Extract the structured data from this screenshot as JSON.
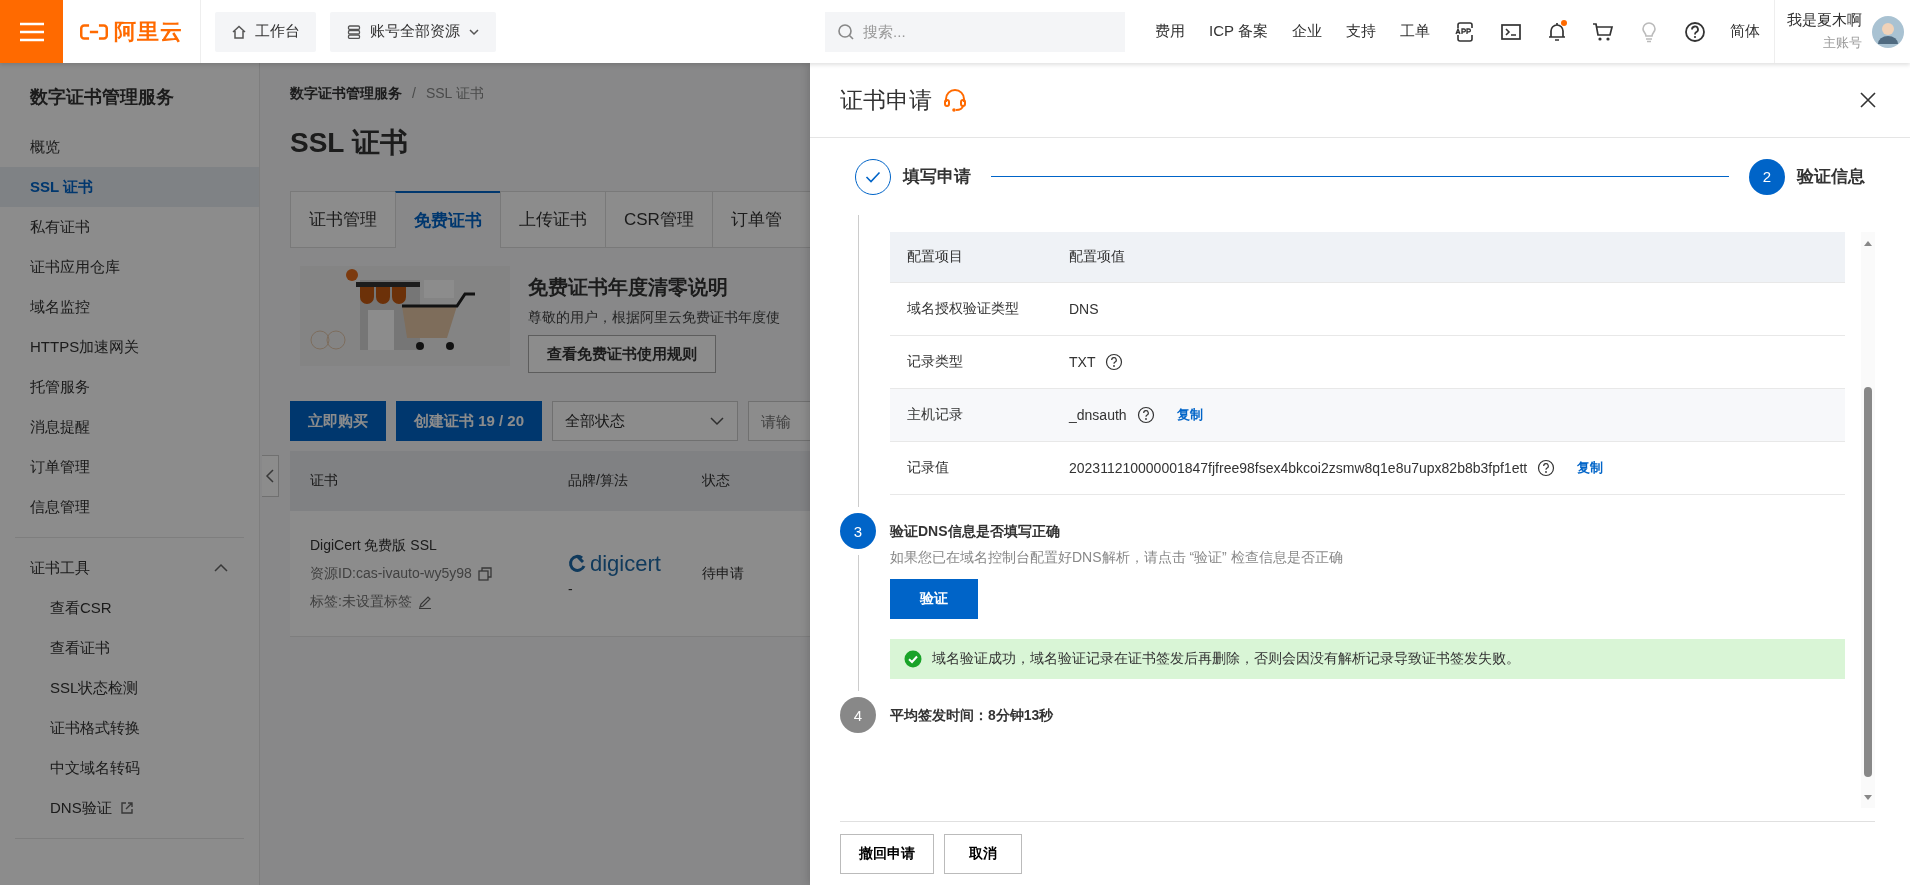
{
  "topbar": {
    "logo": "阿里云",
    "buttons": [
      {
        "kind": "home",
        "label": "工作台"
      },
      {
        "kind": "dropdown",
        "label": "账号全部资源"
      }
    ],
    "search": {
      "placeholder": "搜索..."
    },
    "links": [
      "费用",
      "ICP 备案",
      "企业",
      "支持",
      "工单"
    ],
    "icons": [
      {
        "kind": "app",
        "badge": false,
        "disabled": false
      },
      {
        "kind": "terminal",
        "badge": false,
        "disabled": false
      },
      {
        "kind": "bell",
        "badge": true,
        "disabled": false
      },
      {
        "kind": "cart",
        "badge": false,
        "disabled": false
      },
      {
        "kind": "bulb",
        "badge": false,
        "disabled": true
      },
      {
        "kind": "help",
        "badge": false,
        "disabled": false
      }
    ],
    "language": "简体",
    "user": {
      "name": "我是夏木啊",
      "role": "主账号"
    }
  },
  "sidebar": {
    "title": "数字证书管理服务",
    "items": [
      {
        "label": "概览",
        "selected": false
      },
      {
        "label": "SSL 证书",
        "selected": true
      },
      {
        "label": "私有证书",
        "selected": false
      },
      {
        "label": "证书应用仓库",
        "selected": false
      },
      {
        "label": "域名监控",
        "selected": false
      },
      {
        "label": "HTTPS加速网关",
        "selected": false
      },
      {
        "label": "托管服务",
        "selected": false
      },
      {
        "label": "消息提醒",
        "selected": false
      },
      {
        "label": "订单管理",
        "selected": false
      },
      {
        "label": "信息管理",
        "selected": false
      }
    ],
    "tools": {
      "label": "证书工具",
      "expanded": true,
      "items": [
        {
          "label": "查看CSR",
          "external": false
        },
        {
          "label": "查看证书",
          "external": false
        },
        {
          "label": "SSL状态检测",
          "external": false
        },
        {
          "label": "证书格式转换",
          "external": false
        },
        {
          "label": "中文域名转码",
          "external": false
        },
        {
          "label": "DNS验证",
          "external": true
        }
      ]
    }
  },
  "main": {
    "breadcrumb": {
      "items": [
        "数字证书管理服务",
        "SSL 证书"
      ],
      "separator": "/"
    },
    "title": "SSL 证书",
    "tabs": [
      {
        "label": "证书管理",
        "selected": false
      },
      {
        "label": "免费证书",
        "selected": true
      },
      {
        "label": "上传证书",
        "selected": false
      },
      {
        "label": "CSR管理",
        "selected": false
      },
      {
        "label": "订单管",
        "selected": false
      }
    ],
    "notice": {
      "title": "免费证书年度清零说明",
      "text": "尊敬的用户，根据阿里云免费证书年度使",
      "button": "查看免费证书使用规则"
    },
    "actions": [
      "立即购买",
      "创建证书 19 / 20"
    ],
    "status_filter": "全部状态",
    "search": {
      "placeholder": "请输"
    },
    "table": {
      "columns": [
        "证书",
        "品牌/算法",
        "状态"
      ],
      "rows": [
        {
          "name": "DigiCert 免费版 SSL",
          "resource_id": "资源ID:cas-ivauto-wy5y98",
          "tags": "标签:未设置标签",
          "brand": "digicert",
          "algorithm": "-",
          "status": "待申请"
        }
      ]
    }
  },
  "drawer": {
    "title": "证书申请",
    "steps": [
      {
        "label": "填写申请",
        "completed": true
      },
      {
        "label": "验证信息",
        "number": "2",
        "completed": false
      }
    ],
    "table": {
      "columns": [
        "配置项目",
        "配置项值"
      ],
      "rows": [
        {
          "label": "域名授权验证类型",
          "value": "DNS",
          "help": false,
          "highlighted": false
        },
        {
          "label": "记录类型",
          "value": "TXT",
          "help": true,
          "highlighted": false
        },
        {
          "label": "主机记录",
          "value": "_dnsauth",
          "help": true,
          "copy": "复制",
          "highlighted": true
        },
        {
          "label": "记录值",
          "value": "202311210000001847fjfree98fsex4bkcoi2zsmw8q1e8u7upx82b8b3fpf1ett",
          "help": true,
          "copy": "复制",
          "highlighted": false
        }
      ]
    },
    "timeline": [
      {
        "number": "3",
        "active": true,
        "title": "验证DNS信息是否填写正确",
        "description": "如果您已在域名控制台配置好DNS解析，请点击 “验证” 检查信息是否正确",
        "button": "验证",
        "alert": "域名验证成功，域名验证记录在证书签发后再删除，否则会因没有解析记录导致证书签发失败。"
      },
      {
        "number": "4",
        "active": false,
        "title": "平均签发时间：8分钟13秒"
      }
    ],
    "footer_buttons": [
      "撤回申请",
      "取消"
    ]
  }
}
